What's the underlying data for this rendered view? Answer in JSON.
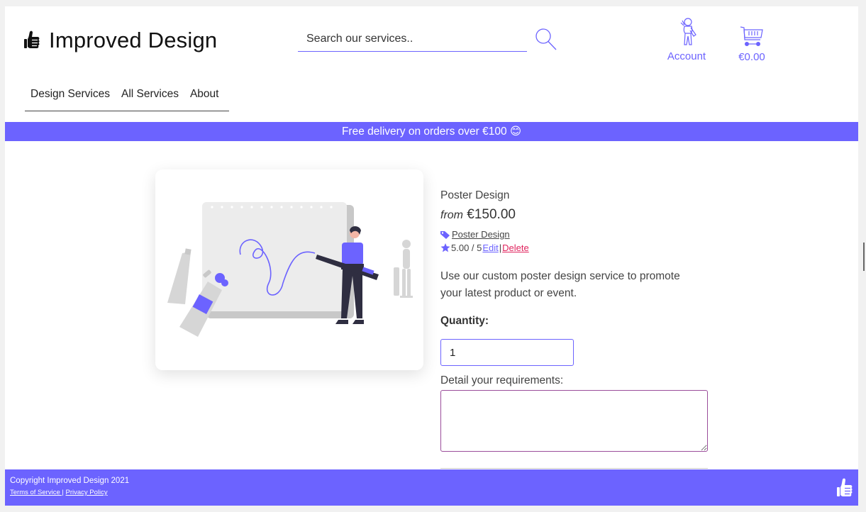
{
  "header": {
    "brand": "Improved Design",
    "search_placeholder": "Search our services..",
    "account_label": "Account",
    "cart_total": "€0.00"
  },
  "nav": {
    "items": [
      "Design Services",
      "All Services",
      "About"
    ]
  },
  "banner": {
    "text": "Free delivery on orders over €100 😊"
  },
  "product": {
    "name": "Poster Design",
    "price_prefix": "from",
    "price": "€150.00",
    "category": "Poster Design",
    "rating": "5.00 / 5",
    "edit_label": "Edit",
    "separator": "|",
    "delete_label": "Delete",
    "description": "Use our custom poster design service to promote your latest product or event.",
    "quantity_label": "Quantity:",
    "quantity_value": "1",
    "requirements_label": "Detail your requirements:"
  },
  "footer": {
    "copyright": "Copyright Improved Design 2021",
    "terms": "Terms of Service |",
    "privacy": "Privacy Policy"
  },
  "colors": {
    "accent": "#6c63ff",
    "delete": "#e0245e"
  },
  "icons": [
    "thumbs-up-icon",
    "search-icon",
    "account-icon",
    "cart-icon",
    "tag-icon",
    "star-icon"
  ]
}
